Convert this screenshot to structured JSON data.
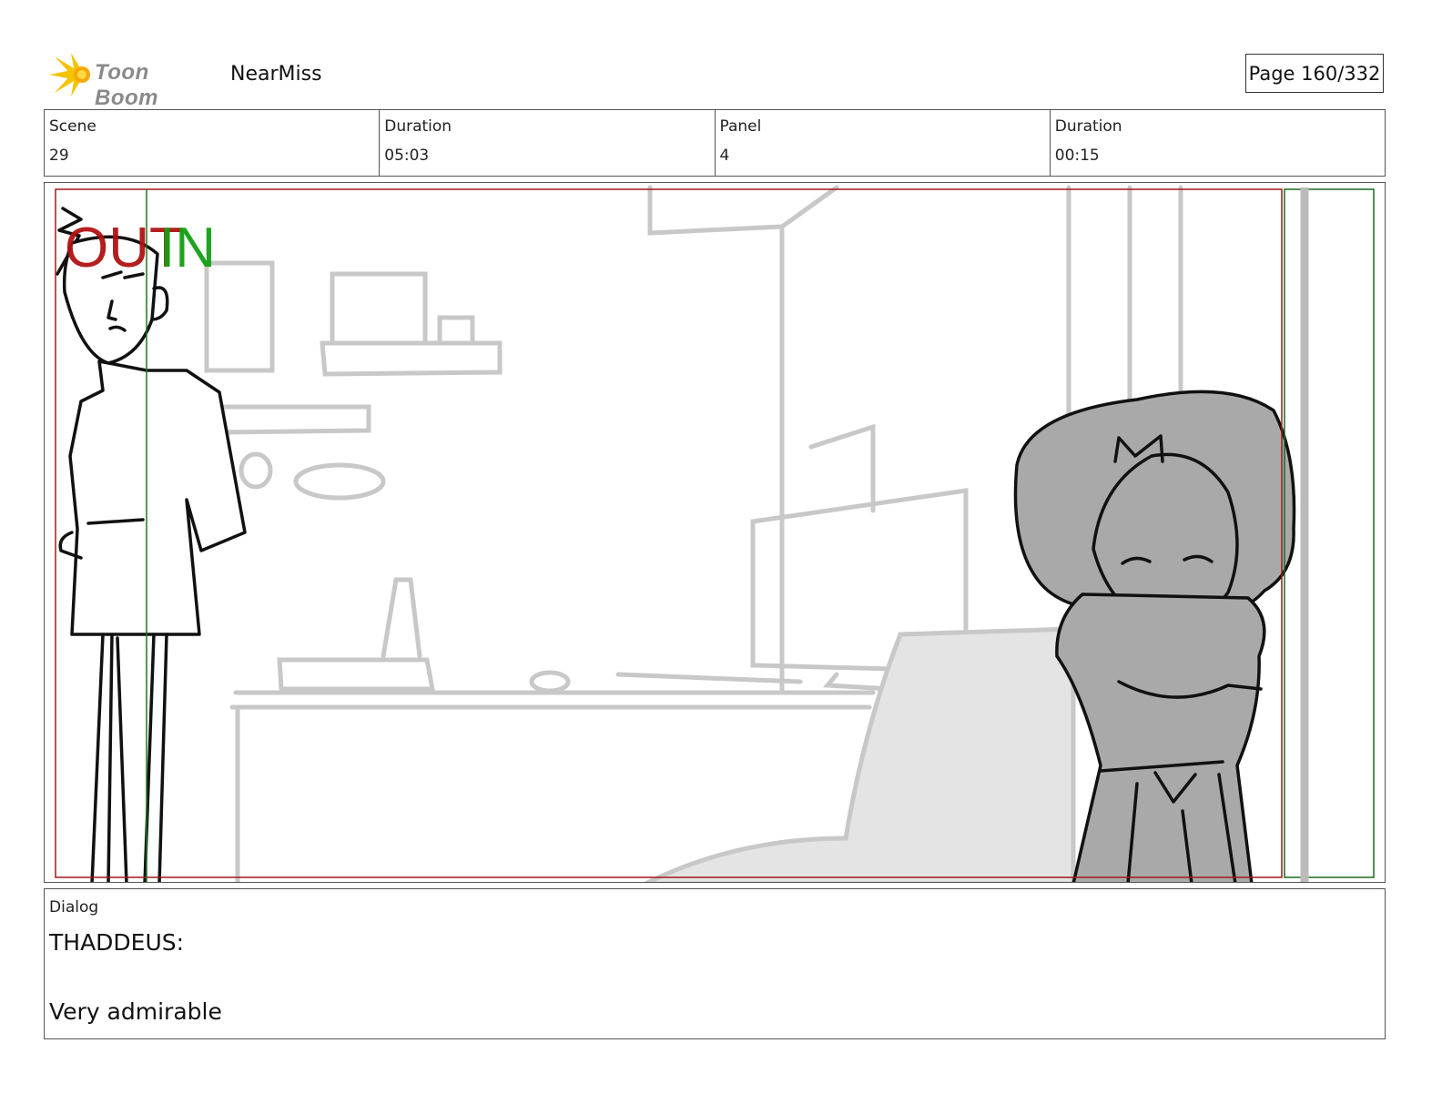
{
  "header": {
    "logo_text": "Toon Boom",
    "project_name": "NearMiss",
    "page_indicator": "Page 160/332"
  },
  "info": {
    "scene_label": "Scene",
    "scene_value": "29",
    "scene_duration_label": "Duration",
    "scene_duration_value": "05:03",
    "panel_label": "Panel",
    "panel_value": "4",
    "panel_duration_label": "Duration",
    "panel_duration_value": "00:15"
  },
  "panel": {
    "out_marker": "OUT",
    "in_marker": "IN",
    "out_color": "#b01212",
    "in_color": "#12a012"
  },
  "dialog": {
    "label": "Dialog",
    "speaker": "THADDEUS:",
    "line": "Very admirable"
  }
}
